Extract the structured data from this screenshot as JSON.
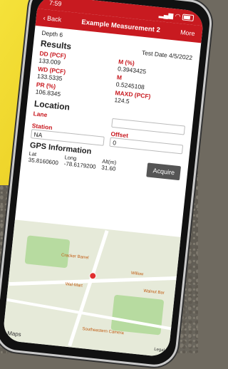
{
  "status": {
    "time": "7:59"
  },
  "nav": {
    "back": "Back",
    "title": "Example Measurement 2",
    "more": "More"
  },
  "depth": "Depth 6",
  "results": {
    "heading": "Results",
    "test_date": "Test Date 4/5/2022",
    "left": [
      {
        "label": "DD (PCF)",
        "value": "133.009"
      },
      {
        "label": "WD (PCF)",
        "value": "133.5335"
      },
      {
        "label": "PR (%)",
        "value": "106.8345"
      }
    ],
    "right": [
      {
        "label": "M (%)",
        "value": "0.3943425"
      },
      {
        "label": "M",
        "value": "0.5245108"
      },
      {
        "label": "MAXD (PCF)",
        "value": "124.5"
      }
    ]
  },
  "location": {
    "heading": "Location",
    "lane_label": "Lane",
    "lane_value": "",
    "station_label": "Station",
    "station_value": "NA",
    "offset_label": "Offset",
    "offset_value": "0"
  },
  "gps": {
    "heading": "GPS Information",
    "lat_label": "Lat",
    "lat_value": "35.8160600",
    "long_label": "Long",
    "long_value": "-78.6179200",
    "alt_label": "Alt(m)",
    "alt_value": "31.60",
    "acquire": "Acquire"
  },
  "map": {
    "labels": [
      "Cracker Barrel",
      "Wal-Mart",
      "Willow",
      "Southeastern Camera",
      "Walnut Bar"
    ],
    "logo": "Maps",
    "legal": "Legal"
  }
}
